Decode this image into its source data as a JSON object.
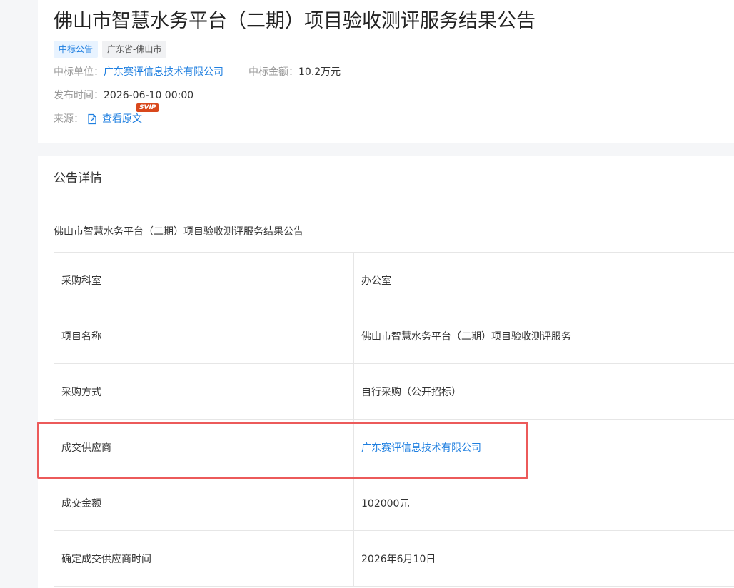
{
  "header": {
    "title": "佛山市智慧水务平台（二期）项目验收测评服务结果公告",
    "tags": [
      "中标公告",
      "广东省-佛山市"
    ],
    "winner_label": "中标单位：",
    "winner_value": "广东赛评信息技术有限公司",
    "amount_label": "中标金额：",
    "amount_value": "10.2万元",
    "publish_label": "发布时间：",
    "publish_value": "2026-06-10 00:00",
    "source_label": "来源：",
    "source_link": "查看原文",
    "svip_badge": "SVIP"
  },
  "detail": {
    "section_title": "公告详情",
    "doc_heading": "佛山市智慧水务平台（二期）项目验收测评服务结果公告",
    "rows": [
      {
        "key": "采购科室",
        "value": "办公室"
      },
      {
        "key": "项目名称",
        "value": "佛山市智慧水务平台（二期）项目验收测评服务"
      },
      {
        "key": "采购方式",
        "value": "自行采购（公开招标）"
      },
      {
        "key": "成交供应商",
        "value": "广东赛评信息技术有限公司"
      },
      {
        "key": "成交金额",
        "value": "102000元"
      },
      {
        "key": "确定成交供应商时间",
        "value": "2026年6月10日"
      }
    ]
  },
  "icons": {
    "source": "document-link-icon"
  },
  "colors": {
    "link": "#1f7fe0",
    "highlight": "#ec5a5a",
    "svip": "#d9481c"
  }
}
